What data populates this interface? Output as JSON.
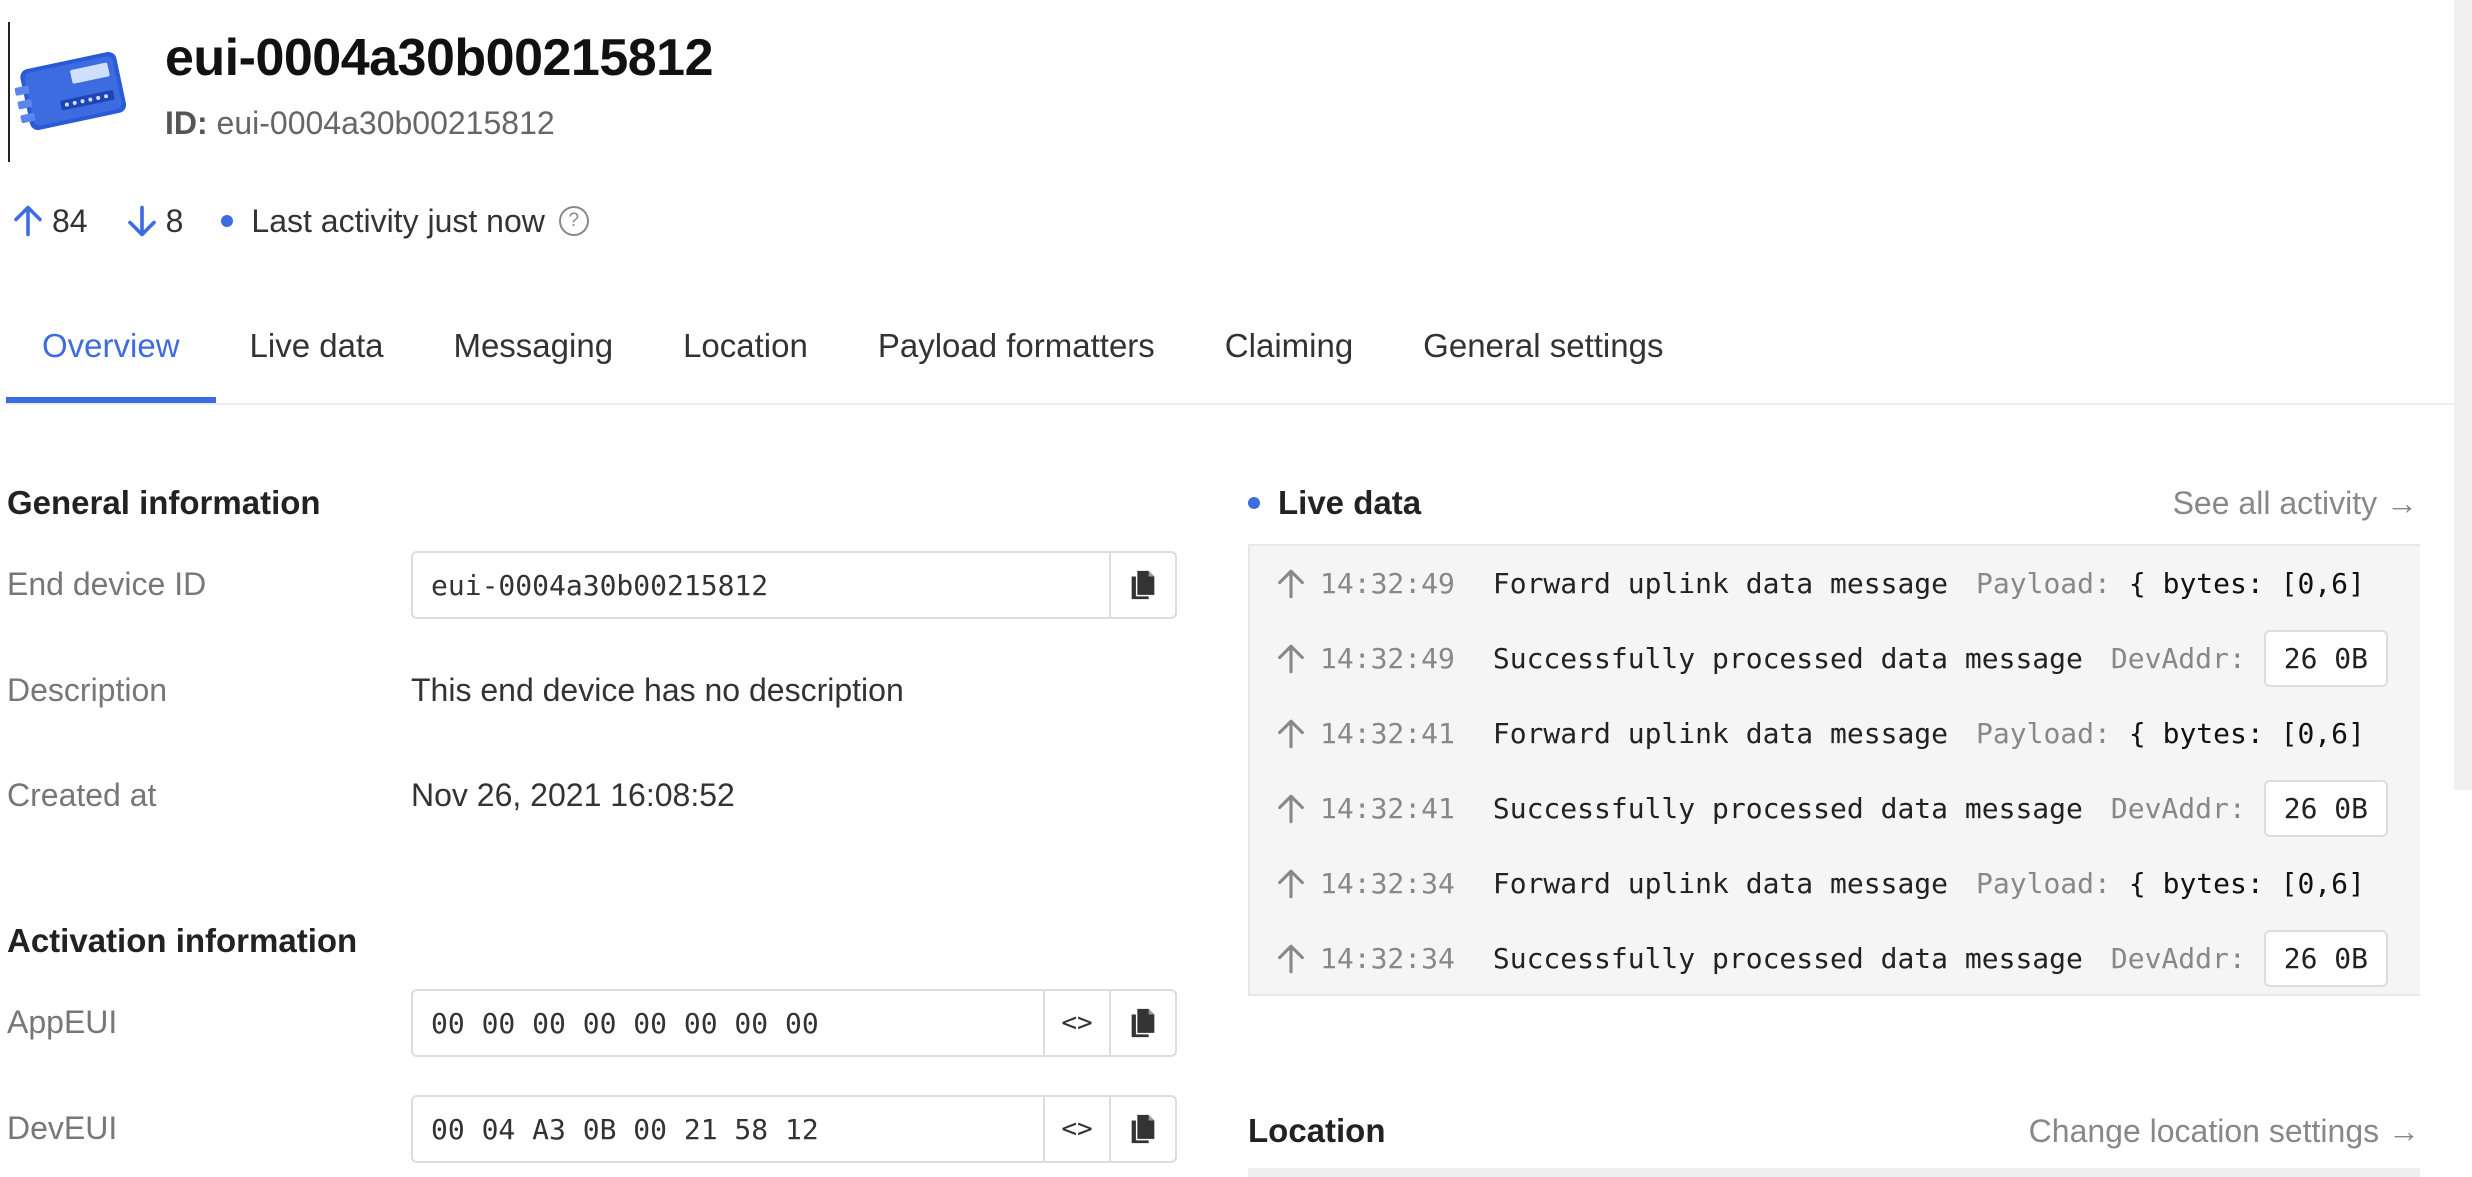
{
  "device": {
    "title": "eui-0004a30b00215812",
    "id_label": "ID:",
    "id_value": "eui-0004a30b00215812"
  },
  "stats": {
    "uplink_count": "84",
    "downlink_count": "8",
    "last_activity": "Last activity just now",
    "help_glyph": "?"
  },
  "tabs": [
    "Overview",
    "Live data",
    "Messaging",
    "Location",
    "Payload formatters",
    "Claiming",
    "General settings"
  ],
  "general": {
    "title": "General information",
    "end_device_id_label": "End device ID",
    "end_device_id_value": "eui-0004a30b00215812",
    "description_label": "Description",
    "description_value": "This end device has no description",
    "created_label": "Created at",
    "created_value": "Nov 26, 2021 16:08:52"
  },
  "activation": {
    "title": "Activation information",
    "appeui_label": "AppEUI",
    "appeui_value": "00 00 00 00 00 00 00 00",
    "deveui_label": "DevEUI",
    "deveui_value": "00 04 A3 0B 00 21 58 12",
    "toggle_glyph": "<>"
  },
  "live": {
    "title": "Live data",
    "see_all": "See all activity →",
    "events": [
      {
        "time": "14:32:49",
        "message": "Forward uplink data message",
        "key": "Payload:",
        "value": "{ bytes: [0,6]",
        "chip": false
      },
      {
        "time": "14:32:49",
        "message": "Successfully processed data message",
        "key": "DevAddr:",
        "value": "26 0B",
        "chip": true
      },
      {
        "time": "14:32:41",
        "message": "Forward uplink data message",
        "key": "Payload:",
        "value": "{ bytes: [0,6]",
        "chip": false
      },
      {
        "time": "14:32:41",
        "message": "Successfully processed data message",
        "key": "DevAddr:",
        "value": "26 0B",
        "chip": true
      },
      {
        "time": "14:32:34",
        "message": "Forward uplink data message",
        "key": "Payload:",
        "value": "{ bytes: [0,6]",
        "chip": false
      },
      {
        "time": "14:32:34",
        "message": "Successfully processed data message",
        "key": "DevAddr:",
        "value": "26 0B",
        "chip": true
      }
    ]
  },
  "location": {
    "title": "Location",
    "change_link": "Change location settings →"
  },
  "colors": {
    "accent": "#3d6be0",
    "muted": "#888888"
  }
}
